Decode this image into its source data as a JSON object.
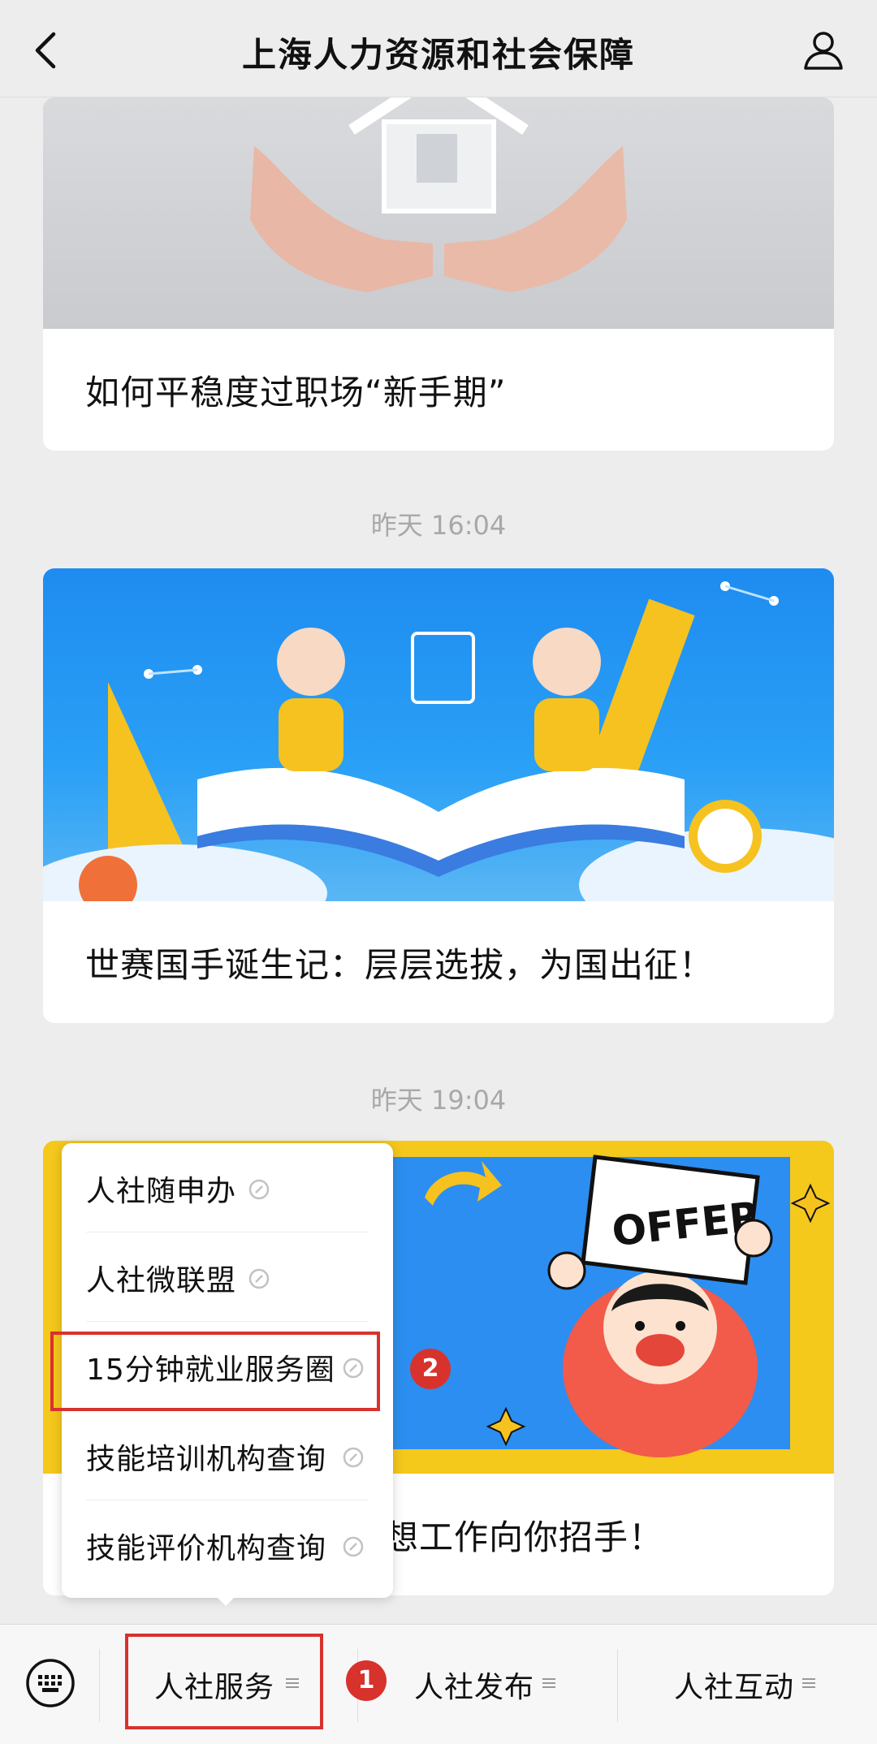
{
  "header": {
    "title": "上海人力资源和社会保障",
    "back_icon": "chevron-left-icon",
    "profile_icon": "person-icon"
  },
  "feed": {
    "articles": [
      {
        "title": "如何平稳度过职场“新手期”",
        "timestamp": ""
      },
      {
        "title": "世赛国手诞生记：层层选拔，为国出征！",
        "timestamp": "昨天 16:04"
      },
      {
        "title": "想工作向你招手！",
        "timestamp": "昨天 19:04",
        "image_text": "OFFER"
      }
    ]
  },
  "popup_menu": {
    "items": [
      {
        "label": "人社随申办",
        "icon": "link-icon"
      },
      {
        "label": "人社微联盟",
        "icon": "link-icon"
      },
      {
        "label": "15分钟就业服务圈",
        "icon": "link-icon"
      },
      {
        "label": "技能培训机构查询",
        "icon": "link-icon"
      },
      {
        "label": "技能评价机构查询",
        "icon": "link-icon"
      }
    ]
  },
  "bottom_bar": {
    "keyboard_icon": "keyboard-icon",
    "tabs": [
      {
        "label": "人社服务",
        "icon": "menu-icon"
      },
      {
        "label": "人社发布",
        "icon": "menu-icon"
      },
      {
        "label": "人社互动",
        "icon": "menu-icon"
      }
    ]
  },
  "annotations": {
    "step1": "1",
    "step2": "2",
    "color": "#d8322d"
  }
}
